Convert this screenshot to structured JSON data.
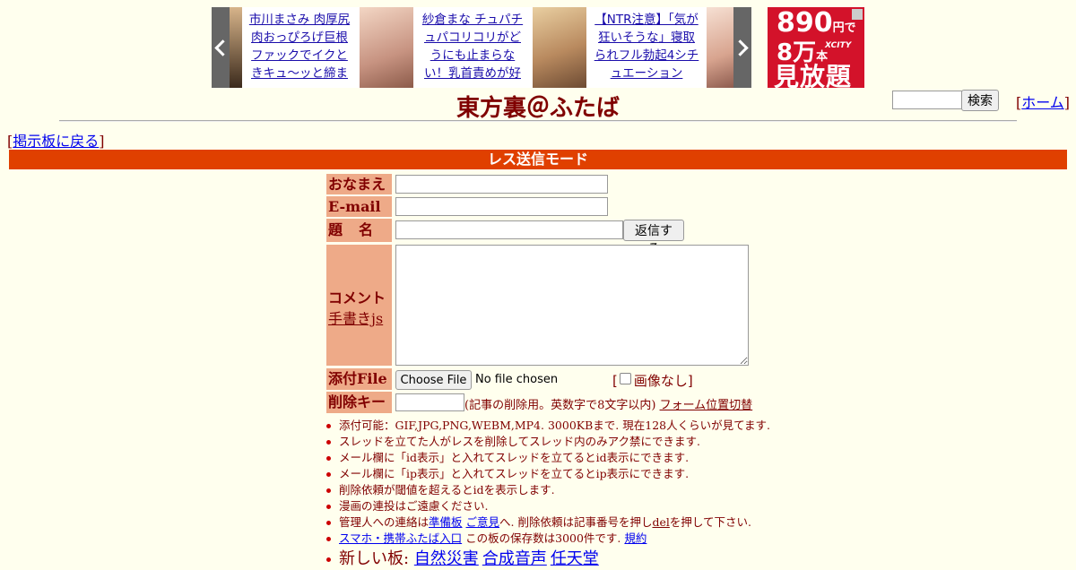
{
  "ads": {
    "items": [
      {
        "text": "市川まさみ 肉厚尻肉おっぴろげ巨根ファックでイクときキュ～ッと締ま"
      },
      {
        "text": "紗倉まな チュパチュパコリコリがどうにも止まらない！乳首責めが好"
      },
      {
        "text": "【NTR注意】「気が狂いそうな」寝取られフル勃起4シチュエーション"
      }
    ],
    "square": {
      "price": "890",
      "price_unit": "円で",
      "count": "8万",
      "count_unit": "本",
      "brand": "XCITY",
      "tagline": "見放題"
    }
  },
  "header": {
    "title": "東方裏＠ふたば",
    "search_button": "検索",
    "home_open": "[",
    "home_link": "ホーム",
    "home_close": "]",
    "back_open": "[",
    "back_link": "掲示板に戻る",
    "back_close": "]"
  },
  "mode_bar": "レス送信モード",
  "form": {
    "labels": {
      "name": "おなまえ",
      "email": "E-mail",
      "subject": "題名",
      "comment": "コメント",
      "handwrite": "手書きjs",
      "file": "添付File",
      "delkey": "削除キー"
    },
    "submit": "返信する",
    "file_button": "Choose File",
    "file_status": "No file chosen",
    "noimg_open": "[",
    "noimg_label": "画像なし",
    "noimg_close": "]",
    "noimg_checked": false,
    "delkey_note": "(記事の削除用。英数字で8文字以内)",
    "form_switch": "フォーム位置切替"
  },
  "notes": {
    "n1": "添付可能：GIF,JPG,PNG,WEBM,MP4. 3000KBまで. 現在128人くらいが見てます.",
    "n2": "スレッドを立てた人がレスを削除してスレッド内のみアク禁にできます.",
    "n3": "メール欄に「id表示」と入れてスレッドを立てるとid表示にできます.",
    "n4": "メール欄に「ip表示」と入れてスレッドを立てるとip表示にできます.",
    "n5": "削除依頼が閾値を超えるとidを表示します.",
    "n6": "漫画の連投はご遠慮ください.",
    "n7_pre": "管理人への連絡は",
    "n7_link1": "準備板",
    "n7_link2": "ご意見",
    "n7_mid": "へ. 削除依頼は記事番号を押し",
    "n7_link3": "del",
    "n7_post": "を押して下さい.",
    "n8_link1": "スマホ・携帯ふたば入口",
    "n8_mid": "この板の保存数は3000件です.",
    "n8_link2": "規約",
    "n9_pre": "新しい板:",
    "n9_links": [
      "自然災害",
      "合成音声",
      "任天堂"
    ]
  }
}
